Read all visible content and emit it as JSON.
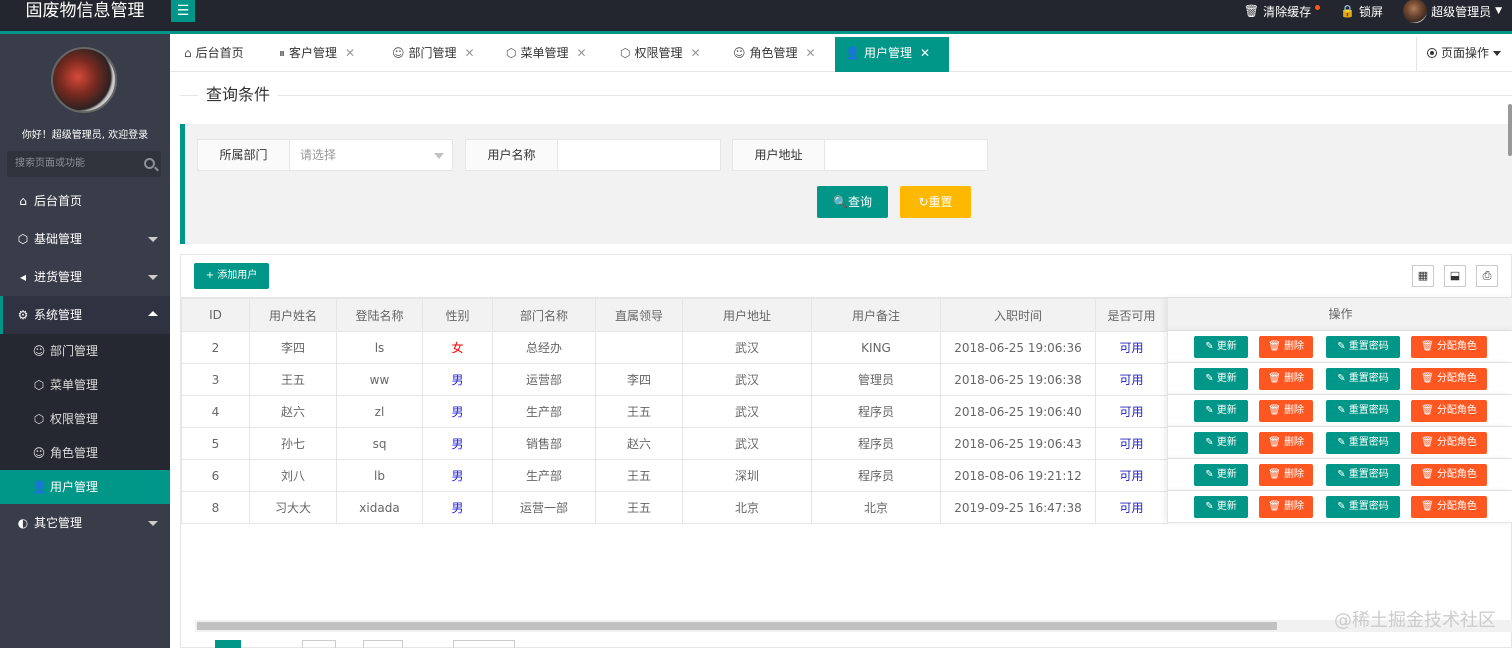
{
  "app": {
    "title": "固废物信息管理"
  },
  "header": {
    "clear_cache": "清除缓存",
    "lock": "锁屏",
    "user": "超级管理员"
  },
  "sidebar": {
    "welcome": "你好！超级管理员, 欢迎登录",
    "search_placeholder": "搜索页面或功能",
    "items": [
      {
        "label": "后台首页",
        "icon": "home-icon"
      },
      {
        "label": "基础管理",
        "icon": "cube-icon"
      },
      {
        "label": "进货管理",
        "icon": "speaker-icon"
      },
      {
        "label": "系统管理",
        "icon": "gear-icon"
      },
      {
        "label": "其它管理",
        "icon": "globe-icon"
      }
    ],
    "sub_items": [
      {
        "label": "部门管理",
        "icon": "user-outline-icon"
      },
      {
        "label": "菜单管理",
        "icon": "cube-icon"
      },
      {
        "label": "权限管理",
        "icon": "cube-icon"
      },
      {
        "label": "角色管理",
        "icon": "smile-icon"
      },
      {
        "label": "用户管理",
        "icon": "user-icon"
      }
    ]
  },
  "tabs": [
    {
      "label": "后台首页",
      "icon": "home-icon"
    },
    {
      "label": "客户管理",
      "icon": "pause-icon"
    },
    {
      "label": "部门管理",
      "icon": "user-outline-icon"
    },
    {
      "label": "菜单管理",
      "icon": "cube-icon"
    },
    {
      "label": "权限管理",
      "icon": "cube-icon"
    },
    {
      "label": "角色管理",
      "icon": "smile-icon"
    },
    {
      "label": "用户管理",
      "icon": "user-icon"
    }
  ],
  "page_op": "页面操作",
  "query": {
    "title": "查询条件",
    "dept_label": "所属部门",
    "dept_placeholder": "请选择",
    "name_label": "用户名称",
    "addr_label": "用户地址",
    "search_btn": "查询",
    "reset_btn": "重置"
  },
  "table": {
    "add_btn": "添加用户",
    "columns": [
      "ID",
      "用户姓名",
      "登陆名称",
      "性别",
      "部门名称",
      "直属领导",
      "用户地址",
      "用户备注",
      "入职时间",
      "是否可用"
    ],
    "ops_header": "操作",
    "op_labels": {
      "update": "更新",
      "delete": "删除",
      "reset_pwd": "重置密码",
      "assign_role": "分配角色"
    },
    "rows": [
      {
        "id": "2",
        "name": "李四",
        "login": "ls",
        "sex": "女",
        "dept": "总经办",
        "leader": "",
        "addr": "武汉",
        "remark": "KING",
        "hired": "2018-06-25 19:06:36",
        "avail": "可用"
      },
      {
        "id": "3",
        "name": "王五",
        "login": "ww",
        "sex": "男",
        "dept": "运营部",
        "leader": "李四",
        "addr": "武汉",
        "remark": "管理员",
        "hired": "2018-06-25 19:06:38",
        "avail": "可用"
      },
      {
        "id": "4",
        "name": "赵六",
        "login": "zl",
        "sex": "男",
        "dept": "生产部",
        "leader": "王五",
        "addr": "武汉",
        "remark": "程序员",
        "hired": "2018-06-25 19:06:40",
        "avail": "可用"
      },
      {
        "id": "5",
        "name": "孙七",
        "login": "sq",
        "sex": "男",
        "dept": "销售部",
        "leader": "赵六",
        "addr": "武汉",
        "remark": "程序员",
        "hired": "2018-06-25 19:06:43",
        "avail": "可用"
      },
      {
        "id": "6",
        "name": "刘八",
        "login": "lb",
        "sex": "男",
        "dept": "生产部",
        "leader": "王五",
        "addr": "深圳",
        "remark": "程序员",
        "hired": "2018-08-06 19:21:12",
        "avail": "可用"
      },
      {
        "id": "8",
        "name": "习大大",
        "login": "xidada",
        "sex": "男",
        "dept": "运营一部",
        "leader": "王五",
        "addr": "北京",
        "remark": "北京",
        "hired": "2019-09-25 16:47:38",
        "avail": "可用"
      }
    ]
  },
  "watermark": "@稀土掘金技术社区",
  "colors": {
    "primary": "#009688",
    "warn": "#ffb800",
    "danger": "#ff5722",
    "sidebar": "#393d49",
    "header": "#23262e"
  }
}
